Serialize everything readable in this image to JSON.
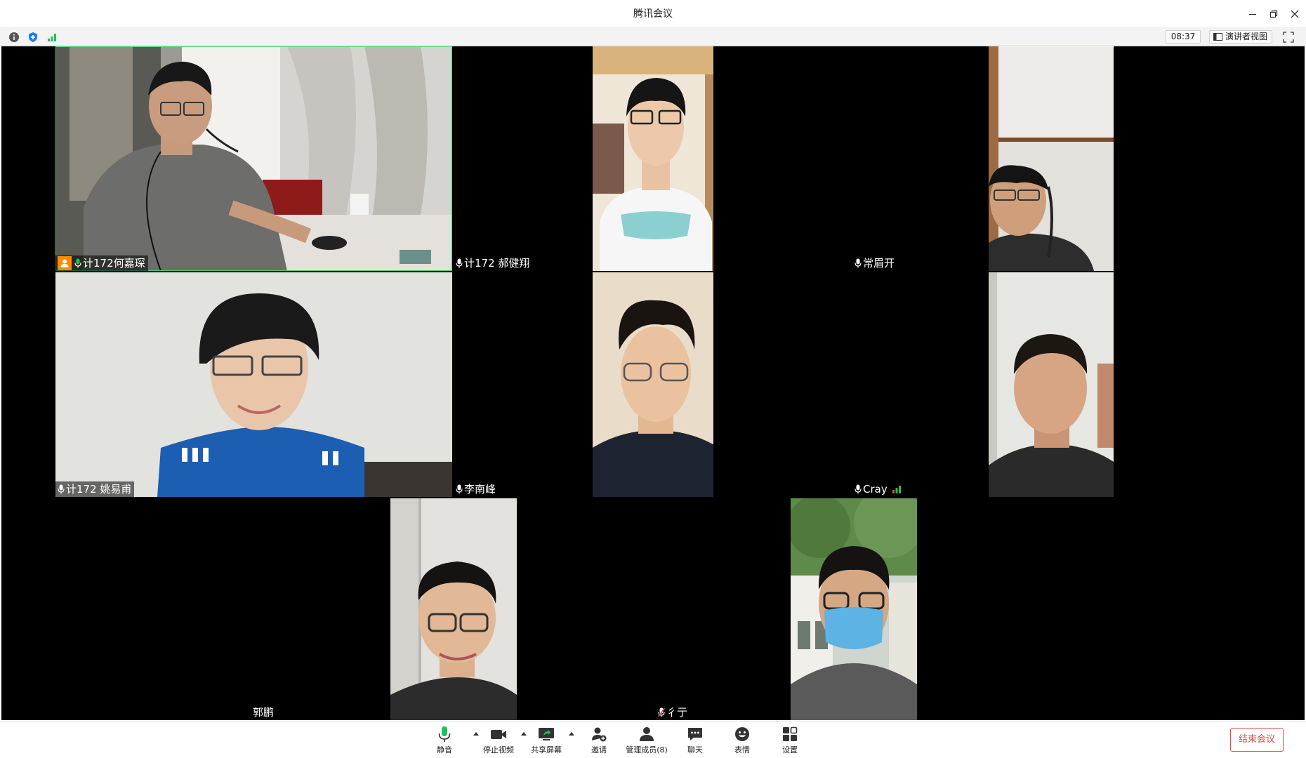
{
  "window": {
    "title": "腾讯会议"
  },
  "infobar": {
    "timer": "08:37",
    "layout_label": "演讲者视图"
  },
  "participants": [
    {
      "name": "计172何嘉琛",
      "video": true,
      "host": true,
      "speaking": true
    },
    {
      "name": "计172 郝健翔",
      "video": true
    },
    {
      "name": "常眉开",
      "video": true
    },
    {
      "name": "计172 姚易甫",
      "video": true
    },
    {
      "name": "李南峰",
      "video": true
    },
    {
      "name": "Cray",
      "video": true
    },
    {
      "name": "郭鹏",
      "video": true
    },
    {
      "name": "彳亍",
      "video": true,
      "muted": true
    }
  ],
  "toolbar": {
    "mute": "静音",
    "stop_video": "停止视频",
    "share_screen": "共享屏幕",
    "invite": "邀请",
    "manage_members": "管理成员(8)",
    "chat": "聊天",
    "reactions": "表情",
    "settings": "设置",
    "end_meeting": "结束会议"
  },
  "colors": {
    "accent_green": "#1ec05a",
    "active_speaker_border": "#3fd26a",
    "host_badge": "#ff8a00",
    "end_button": "#e84a4a",
    "shield_blue": "#1a7dff"
  }
}
